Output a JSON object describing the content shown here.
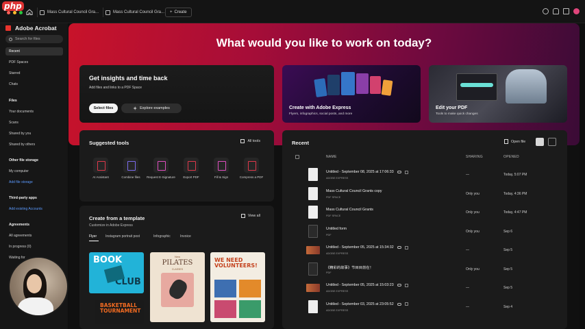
{
  "browser": {
    "logo": "php",
    "tabs": [
      {
        "title": "Mass Cultural Council Gra..."
      },
      {
        "title": "Mass Cultural Council Gra..."
      }
    ],
    "create_label": "Create"
  },
  "sidebar": {
    "app_title": "Adobe Acrobat",
    "search_placeholder": "Search for files",
    "items": [
      {
        "label": "Recent",
        "active": true
      },
      {
        "label": "PDF Spaces"
      },
      {
        "label": "Starred"
      },
      {
        "label": "Chats"
      }
    ],
    "files_header": "Files",
    "files_items": [
      "Your documents",
      "Scans",
      "Shared by you",
      "Shared by others"
    ],
    "other_storage_header": "Other file storage",
    "other_storage_items": [
      "My computer"
    ],
    "add_storage": "Add file storage",
    "third_party_header": "Third-party apps",
    "connect_accounts": "Add existing Accounts",
    "agreements_header": "Agreements",
    "agreements_items": [
      "All agreements",
      "In progress (0)",
      "Waiting for"
    ]
  },
  "hero": {
    "title": "What would you like to work on today?",
    "insights_title": "Get insights and time back",
    "insights_sub": "Add files and links to a PDF Space",
    "select_files": "Select files",
    "explore": "Explore examples",
    "express_title": "Create with Adobe Express",
    "express_sub": "Flyers, infographics, social posts, and more",
    "edit_title": "Edit your PDF",
    "edit_sub": "Tools to make quick changes"
  },
  "tools": {
    "title": "Suggested tools",
    "all_tools": "All tools",
    "items": [
      {
        "label": "AI Assistant",
        "color": "#e0384b"
      },
      {
        "label": "Combine files",
        "color": "#7c6cf0"
      },
      {
        "label": "Request E-Signature",
        "color": "#e04ec0"
      },
      {
        "label": "Export PDF",
        "color": "#e0384b"
      },
      {
        "label": "Fill & Sign",
        "color": "#e04ec0"
      },
      {
        "label": "Compress a PDF",
        "color": "#e0384b"
      }
    ]
  },
  "template": {
    "title": "Create from a template",
    "sub": "Customize in Adobe Express",
    "view_all": "View all",
    "tabs": [
      "Flyer",
      "Instagram portrait post",
      "Infographic",
      "Invoice"
    ],
    "thumb_texts": {
      "book": "BOOK",
      "club": "CLUB",
      "pilates_small": "New",
      "pilates": "PILATES",
      "pilates_sub": "CLASSES",
      "volunteers": "WE NEED VOLUNTEERS!",
      "basketball": "BASKETBALL TOURNAMENT"
    }
  },
  "recent": {
    "title": "Recent",
    "open_file": "Open file",
    "columns": {
      "name": "NAME",
      "sharing": "SHARING",
      "opened": "OPENED"
    },
    "rows": [
      {
        "name": "Untitled - September 08, 2025 at 17:06:33",
        "type": "ADOBE EXPRESS",
        "sharing": "—",
        "opened": "Today, 5:07 PM",
        "thumb": "tall",
        "cloud": true
      },
      {
        "name": "Mass Cultural Council Grants copy",
        "type": "PDF SPACE",
        "sharing": "Only you",
        "opened": "Today, 4:36 PM",
        "thumb": "tall",
        "cloud": false
      },
      {
        "name": "Mass Cultural Council Grants",
        "type": "PDF SPACE",
        "sharing": "Only you",
        "opened": "Today, 4:47 PM",
        "thumb": "tall",
        "cloud": false
      },
      {
        "name": "Untitled form",
        "type": "PDF",
        "sharing": "Only you",
        "opened": "Sep 6",
        "thumb": "icon",
        "cloud": false
      },
      {
        "name": "Untitled - September 05, 2025 at 15:34:32",
        "type": "ADOBE EXPRESS",
        "sharing": "—",
        "opened": "Sep 5",
        "thumb": "wide",
        "cloud": true
      },
      {
        "name": "《精彩的故事》节目目前在！",
        "type": "PDF",
        "sharing": "Only you",
        "opened": "Sep 5",
        "thumb": "icon",
        "cloud": false
      },
      {
        "name": "Untitled - September 05, 2025 at 15:03:23",
        "type": "ADOBE EXPRESS",
        "sharing": "—",
        "opened": "Sep 5",
        "thumb": "wide",
        "cloud": true
      },
      {
        "name": "Untitled - September 03, 2025 at 23:05:52",
        "type": "ADOBE EXPRESS",
        "sharing": "—",
        "opened": "Sep 4",
        "thumb": "tall",
        "cloud": true
      }
    ]
  },
  "colors": {
    "accent_red": "#e8342d",
    "link_blue": "#5c9bff",
    "hero_start": "#c8132a",
    "hero_end": "#3a0b36"
  }
}
